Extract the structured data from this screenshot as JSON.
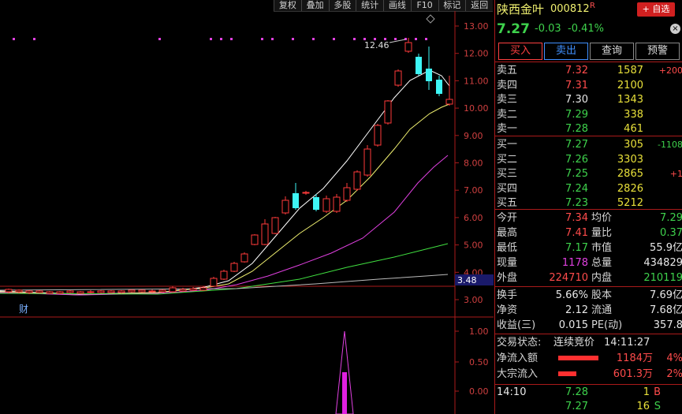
{
  "toolbar": {
    "items": [
      "复权",
      "叠加",
      "多股",
      "统计",
      "画线",
      "F10",
      "标记",
      "返回"
    ]
  },
  "chart": {
    "price_axis": [
      "13.00",
      "12.00",
      "11.00",
      "10.00",
      "9.00",
      "8.00",
      "7.00",
      "6.00",
      "5.00",
      "4.00",
      "3.00"
    ],
    "current_price_tag": "3.48",
    "high_annotation": "12.46",
    "fin_marker": "财",
    "indicator_axis": [
      "1.00",
      "0.50",
      "0.00"
    ],
    "colors": {
      "up": "#ff3a3a",
      "down": "#3ef6f6",
      "ma5": "#ffffff",
      "ma10": "#f0f070",
      "ma20": "#e040e0",
      "ma60": "#40e040"
    }
  },
  "stock": {
    "name": "陕西金叶",
    "code": "000812",
    "tag": "R",
    "price": "7.27",
    "change": "-0.03",
    "pct": "-0.41%"
  },
  "buttons": {
    "add_fav": "+ 自选",
    "buy": "买入",
    "sell": "卖出",
    "query": "查询",
    "alert": "预警"
  },
  "asks": [
    {
      "label": "卖五",
      "price": "7.32",
      "vol": "1587",
      "chg": "+200"
    },
    {
      "label": "卖四",
      "price": "7.31",
      "vol": "2100",
      "chg": ""
    },
    {
      "label": "卖三",
      "price": "7.30",
      "vol": "1343",
      "chg": ""
    },
    {
      "label": "卖二",
      "price": "7.29",
      "vol": "338",
      "chg": ""
    },
    {
      "label": "卖一",
      "price": "7.28",
      "vol": "461",
      "chg": ""
    }
  ],
  "bids": [
    {
      "label": "买一",
      "price": "7.27",
      "vol": "305",
      "chg": "-1108"
    },
    {
      "label": "买二",
      "price": "7.26",
      "vol": "3303",
      "chg": ""
    },
    {
      "label": "买三",
      "price": "7.25",
      "vol": "2865",
      "chg": "+1"
    },
    {
      "label": "买四",
      "price": "7.24",
      "vol": "2826",
      "chg": ""
    },
    {
      "label": "买五",
      "price": "7.23",
      "vol": "5212",
      "chg": ""
    }
  ],
  "stats": [
    {
      "l1": "今开",
      "v1": "7.34",
      "c1": "red",
      "l2": "均价",
      "v2": "7.29",
      "c2": "green"
    },
    {
      "l1": "最高",
      "v1": "7.41",
      "c1": "red",
      "l2": "量比",
      "v2": "0.37",
      "c2": "green"
    },
    {
      "l1": "最低",
      "v1": "7.17",
      "c1": "green",
      "l2": "市值",
      "v2": "55.9亿",
      "c2": "white"
    },
    {
      "l1": "现量",
      "v1": "1178",
      "c1": "mag",
      "l2": "总量",
      "v2": "434829",
      "c2": "white"
    },
    {
      "l1": "外盘",
      "v1": "224710",
      "c1": "red",
      "l2": "内盘",
      "v2": "210119",
      "c2": "green"
    }
  ],
  "stats2": [
    {
      "l1": "换手",
      "v1": "5.66%",
      "l2": "股本",
      "v2": "7.69亿"
    },
    {
      "l1": "净资",
      "v1": "2.12",
      "l2": "流通",
      "v2": "7.68亿"
    },
    {
      "l1": "收益(三)",
      "v1": "0.015",
      "l2": "PE(动)",
      "v2": "357.8"
    }
  ],
  "status": {
    "label": "交易状态:",
    "value": "连续竞价",
    "time": "14:11:27"
  },
  "flows": [
    {
      "label": "净流入额",
      "amount": "1184万",
      "pct": "4%",
      "bar": 0.78
    },
    {
      "label": "大宗流入",
      "amount": "601.3万",
      "pct": "2%",
      "bar": 0.36
    }
  ],
  "ticks": [
    {
      "time": "14:10",
      "price": "7.28",
      "vol": "1",
      "side": "B"
    },
    {
      "time": "",
      "price": "7.27",
      "vol": "16",
      "side": "S"
    }
  ]
}
